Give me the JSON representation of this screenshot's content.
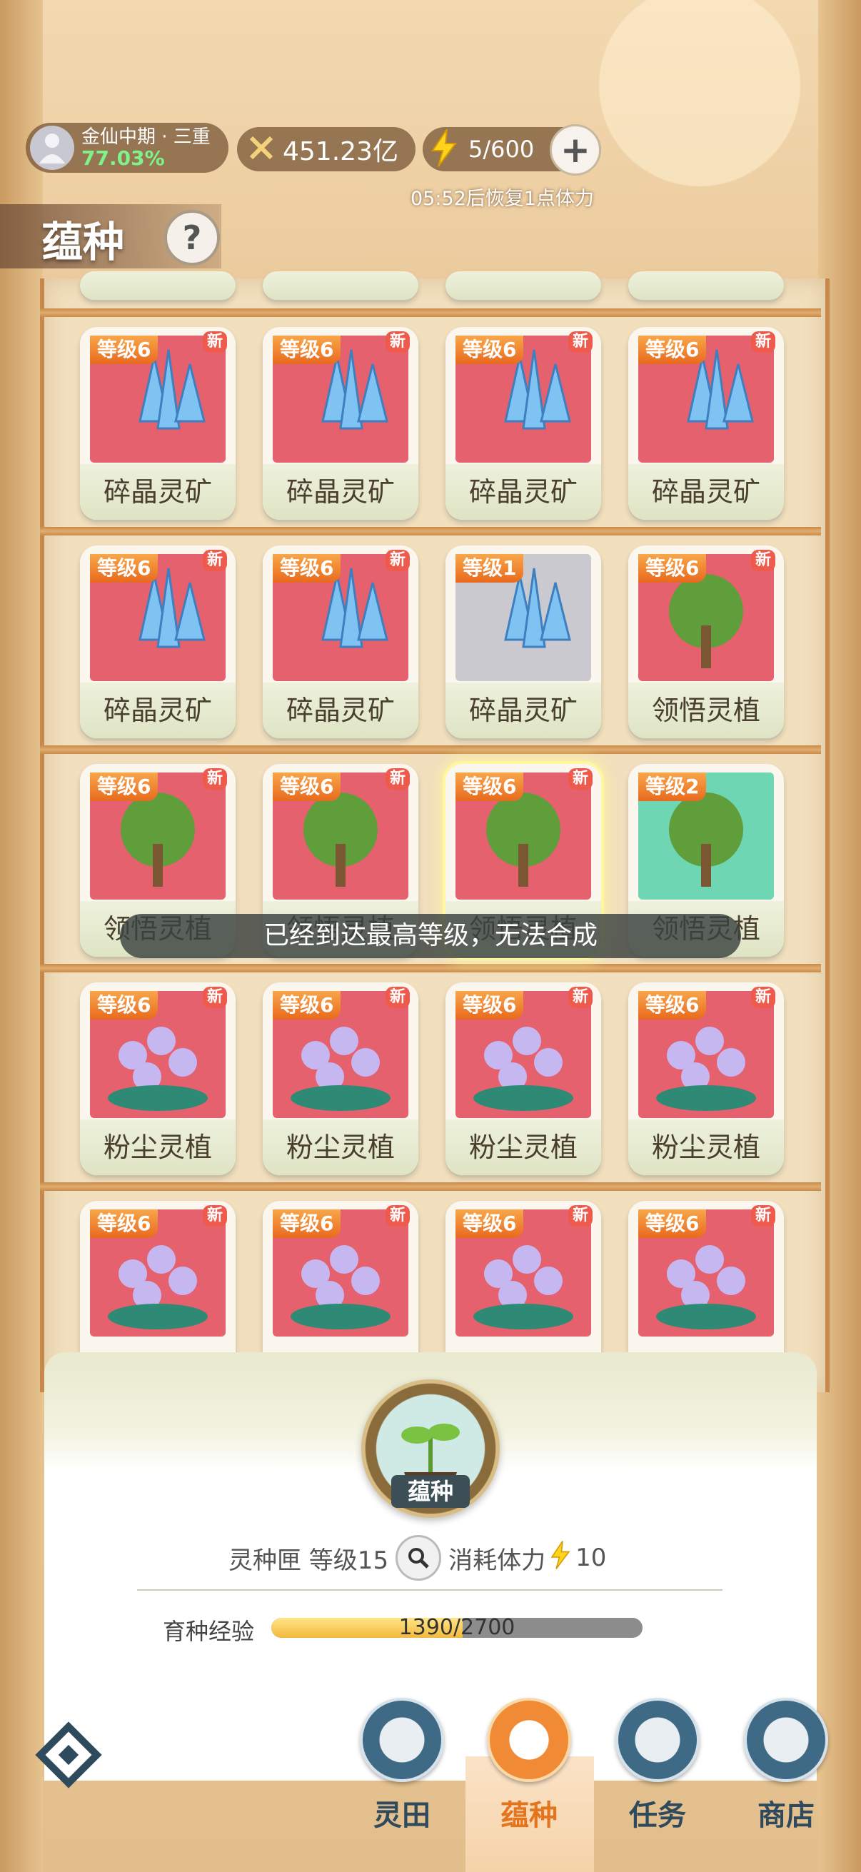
{
  "header": {
    "realm_name": "金仙中期 · 三重",
    "realm_progress": "77.03%",
    "power": "451.23亿",
    "stamina": "5/600",
    "stamina_recover": "05:52后恢复1点体力",
    "plus": "+"
  },
  "page": {
    "title": "蕴种",
    "help": "?"
  },
  "grid": {
    "rows": [
      [
        {
          "level": "等级6",
          "name": "碎晶灵矿",
          "new": "新"
        },
        {
          "level": "等级6",
          "name": "碎晶灵矿",
          "new": "新"
        },
        {
          "level": "等级6",
          "name": "碎晶灵矿",
          "new": "新"
        },
        {
          "level": "等级6",
          "name": "碎晶灵矿",
          "new": "新"
        }
      ],
      [
        {
          "level": "等级6",
          "name": "碎晶灵矿",
          "new": "新"
        },
        {
          "level": "等级6",
          "name": "碎晶灵矿",
          "new": "新"
        },
        {
          "level": "等级1",
          "name": "碎晶灵矿",
          "new": ""
        },
        {
          "level": "等级6",
          "name": "领悟灵植",
          "new": "新"
        }
      ],
      [
        {
          "level": "等级6",
          "name": "领悟灵植",
          "new": "新"
        },
        {
          "level": "等级6",
          "name": "领悟灵植",
          "new": "新"
        },
        {
          "level": "等级6",
          "name": "领悟灵植",
          "new": "新"
        },
        {
          "level": "等级2",
          "name": "领悟灵植",
          "new": ""
        }
      ],
      [
        {
          "level": "等级6",
          "name": "粉尘灵植",
          "new": "新"
        },
        {
          "level": "等级6",
          "name": "粉尘灵植",
          "new": "新"
        },
        {
          "level": "等级6",
          "name": "粉尘灵植",
          "new": "新"
        },
        {
          "level": "等级6",
          "name": "粉尘灵植",
          "new": "新"
        }
      ],
      [
        {
          "level": "等级6",
          "name": "",
          "new": "新"
        },
        {
          "level": "等级6",
          "name": "",
          "new": "新"
        },
        {
          "level": "等级6",
          "name": "",
          "new": "新"
        },
        {
          "level": "等级6",
          "name": "",
          "new": "新"
        }
      ]
    ]
  },
  "toast": "已经到达最高等级，无法合成",
  "panel": {
    "seed_button": "蕴种",
    "box_level": "灵种匣 等级15",
    "stamina_cost_label": "消耗体力",
    "stamina_cost": "10",
    "exp_label": "育种经验",
    "exp_text": "1390/2700",
    "exp_fraction": 0.515
  },
  "nav": {
    "items": [
      {
        "label": "灵田"
      },
      {
        "label": "蕴种"
      },
      {
        "label": "任务"
      },
      {
        "label": "商店"
      }
    ]
  },
  "colors": {
    "card_red": "#e4616d",
    "level_badge": "#f08a35",
    "nav_active": "#e5741e",
    "nav_text": "#2f4a5d"
  }
}
